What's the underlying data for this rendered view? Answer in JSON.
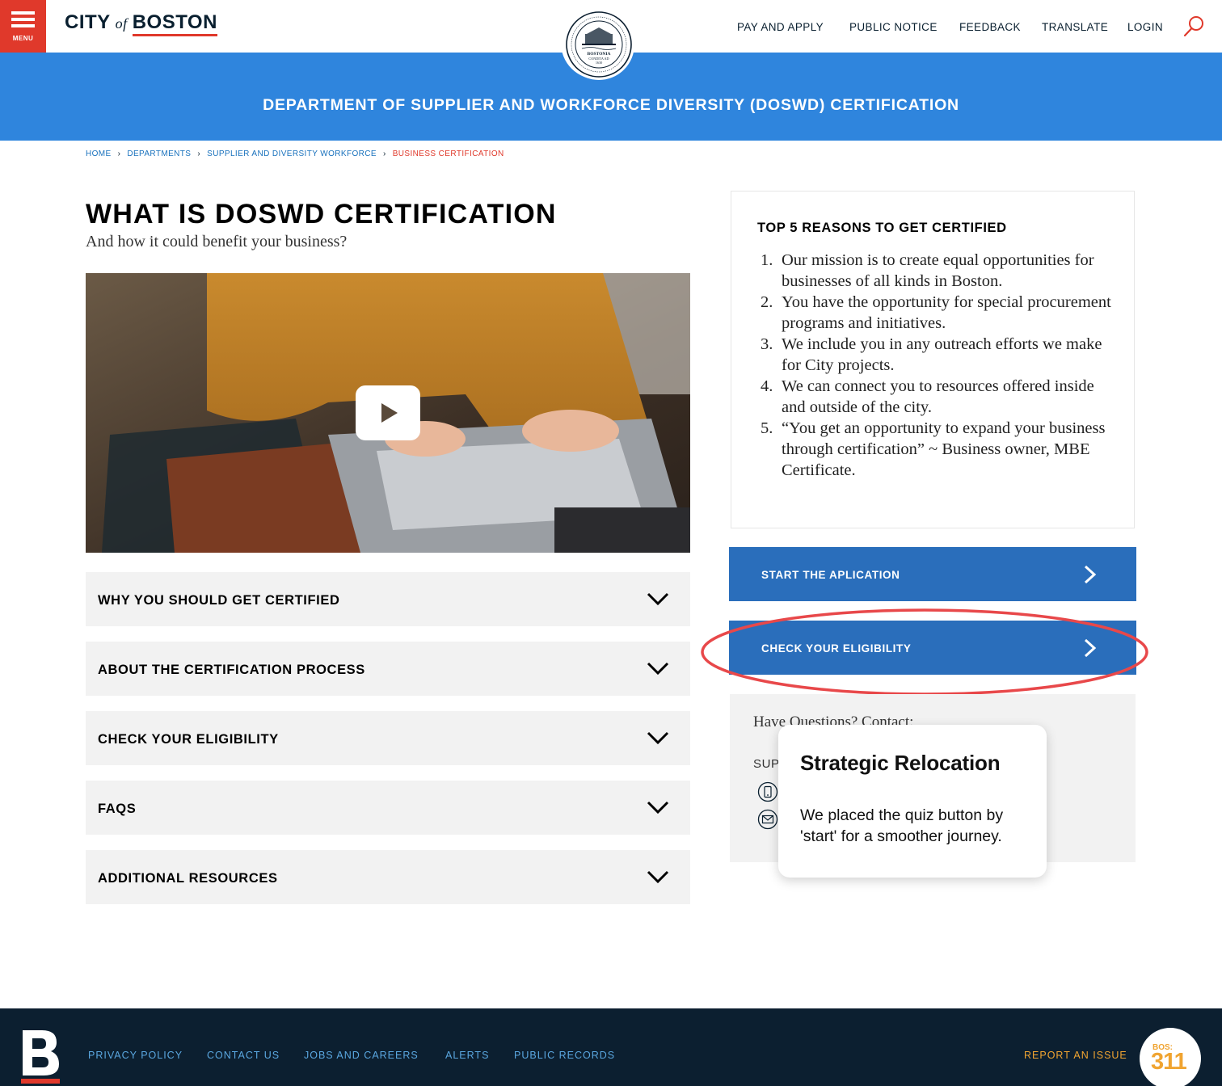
{
  "header": {
    "menu_label": "MENU",
    "logo_city": "CITY",
    "logo_of": "of",
    "logo_boston": "BOSTON",
    "seal_text_top": "BOSTONIA",
    "seal_text_mid": "CONDITA AD",
    "seal_text_year": "1630",
    "nav": [
      "PAY AND APPLY",
      "PUBLIC NOTICE",
      "FEEDBACK",
      "TRANSLATE",
      "LOGIN"
    ]
  },
  "banner": {
    "title": "DEPARTMENT OF SUPPLIER AND WORKFORCE DIVERSITY (DOSWD) CERTIFICATION"
  },
  "breadcrumb": [
    "HOME",
    "DEPARTMENTS",
    "SUPPLIER AND DIVERSITY WORKFORCE",
    "BUSINESS CERTIFICATION"
  ],
  "main": {
    "title": "WHAT IS DOSWD CERTIFICATION",
    "subtitle": "And how it could benefit your business?",
    "accordions": [
      "WHY YOU SHOULD GET CERTIFIED",
      "ABOUT THE CERTIFICATION PROCESS",
      "CHECK YOUR ELIGIBILITY",
      "FAQS",
      "ADDITIONAL RESOURCES"
    ]
  },
  "reasons": {
    "title": "TOP 5 REASONS TO GET CERTIFIED",
    "items": [
      "Our mission is to create equal opportunities for businesses of all kinds in Boston.",
      "You have the opportunity for special procurement programs and initiatives.",
      "We include you in any outreach efforts we make for City projects.",
      "We can connect you to resources offered inside and outside of the city.",
      "“You get an opportunity to expand your business through certification” ~ Business owner, MBE Certificate."
    ]
  },
  "cta": {
    "start_label": "START THE APLICATION",
    "eligibility_label": "CHECK YOUR ELIGIBILITY"
  },
  "contact": {
    "heading": "Have Questions? Contact:",
    "sub_label": "SUP"
  },
  "tooltip": {
    "title": "Strategic Relocation",
    "body": "We placed the quiz button by 'start' for a smoother journey."
  },
  "footer": {
    "links": [
      "PRIVACY POLICY",
      "CONTACT US",
      "JOBS AND CAREERS",
      "ALERTS",
      "PUBLIC RECORDS"
    ],
    "report": "REPORT AN ISSUE",
    "bos_small": "BOS:",
    "bos_big": "311"
  },
  "colors": {
    "brand_red": "#e0392b",
    "banner_blue": "#2f85dd",
    "cta_blue": "#2a6ebb",
    "navy": "#0c1f30",
    "link_blue": "#1871bd",
    "footer_link": "#5aa7e0",
    "accent_orange": "#f0a431"
  }
}
